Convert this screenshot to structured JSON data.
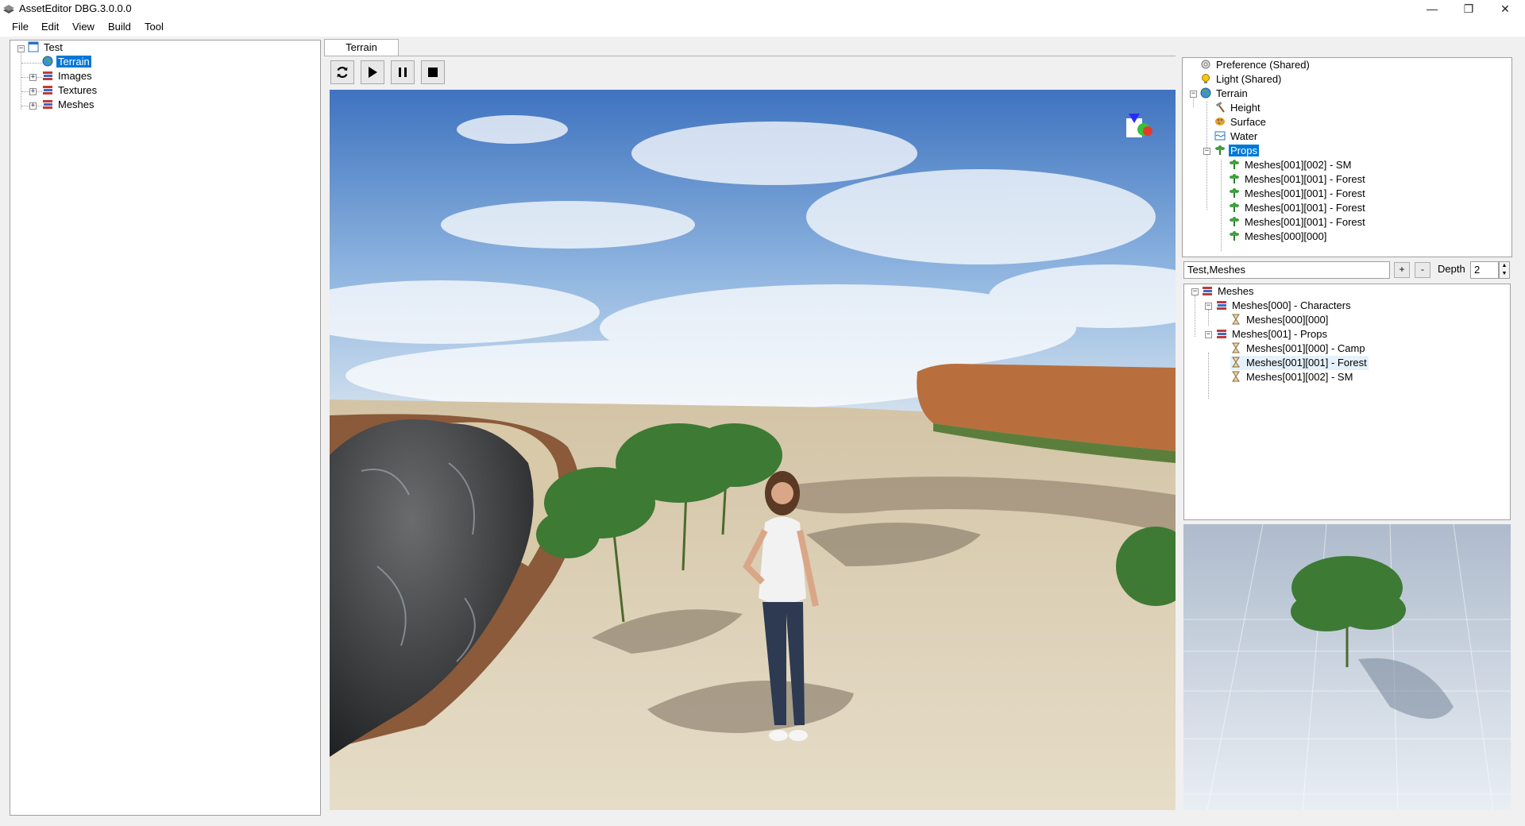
{
  "window": {
    "title": "AssetEditor DBG.3.0.0.0",
    "controls": {
      "minimize": "—",
      "maximize": "❐",
      "close": "✕"
    }
  },
  "menu": [
    "File",
    "Edit",
    "View",
    "Build",
    "Tool"
  ],
  "project_tree": {
    "root": "Test",
    "items": [
      {
        "label": "Terrain",
        "icon": "globe-icon",
        "selected": true
      },
      {
        "label": "Images",
        "icon": "books-icon"
      },
      {
        "label": "Textures",
        "icon": "books-icon"
      },
      {
        "label": "Meshes",
        "icon": "books-icon"
      }
    ]
  },
  "editor": {
    "tab_label": "Terrain",
    "toolbar": [
      "refresh-icon",
      "play-icon",
      "pause-icon",
      "stop-icon"
    ]
  },
  "scene_tree": {
    "items": [
      {
        "label": "Preference (Shared)",
        "icon": "gear-icon",
        "level": 0
      },
      {
        "label": "Light (Shared)",
        "icon": "lightbulb-icon",
        "level": 0
      },
      {
        "label": "Terrain",
        "icon": "globe-icon",
        "level": 0
      },
      {
        "label": "Height",
        "icon": "hammer-icon",
        "level": 1
      },
      {
        "label": "Surface",
        "icon": "palette-icon",
        "level": 1
      },
      {
        "label": "Water",
        "icon": "water-icon",
        "level": 1
      },
      {
        "label": "Props",
        "icon": "plant-icon",
        "level": 1,
        "selected": true
      },
      {
        "label": "Meshes[001][002] - SM",
        "icon": "plant-icon",
        "level": 2
      },
      {
        "label": "Meshes[001][001] - Forest",
        "icon": "plant-icon",
        "level": 2
      },
      {
        "label": "Meshes[001][001] - Forest",
        "icon": "plant-icon",
        "level": 2
      },
      {
        "label": "Meshes[001][001] - Forest",
        "icon": "plant-icon",
        "level": 2
      },
      {
        "label": "Meshes[001][001] - Forest",
        "icon": "plant-icon",
        "level": 2
      },
      {
        "label": "Meshes[000][000]",
        "icon": "plant-icon",
        "level": 2
      }
    ]
  },
  "filter": {
    "path": "Test,Meshes",
    "add_label": "+",
    "remove_label": "-",
    "depth_label": "Depth",
    "depth_value": "2"
  },
  "asset_tree": {
    "items": [
      {
        "label": "Meshes",
        "icon": "books-icon",
        "level": 0
      },
      {
        "label": "Meshes[000] - Characters",
        "icon": "books-icon",
        "level": 1
      },
      {
        "label": "Meshes[000][000]",
        "icon": "hourglass-icon",
        "level": 2
      },
      {
        "label": "Meshes[001] - Props",
        "icon": "books-icon",
        "level": 1
      },
      {
        "label": "Meshes[001][000] - Camp",
        "icon": "hourglass-icon",
        "level": 2
      },
      {
        "label": "Meshes[001][001] - Forest",
        "icon": "hourglass-icon",
        "level": 2,
        "hover": true
      },
      {
        "label": "Meshes[001][002] - SM",
        "icon": "hourglass-icon",
        "level": 2
      }
    ]
  },
  "colors": {
    "selection": "#0078d7",
    "sky": "#4a7cc4",
    "sand": "#d8cbb0"
  }
}
